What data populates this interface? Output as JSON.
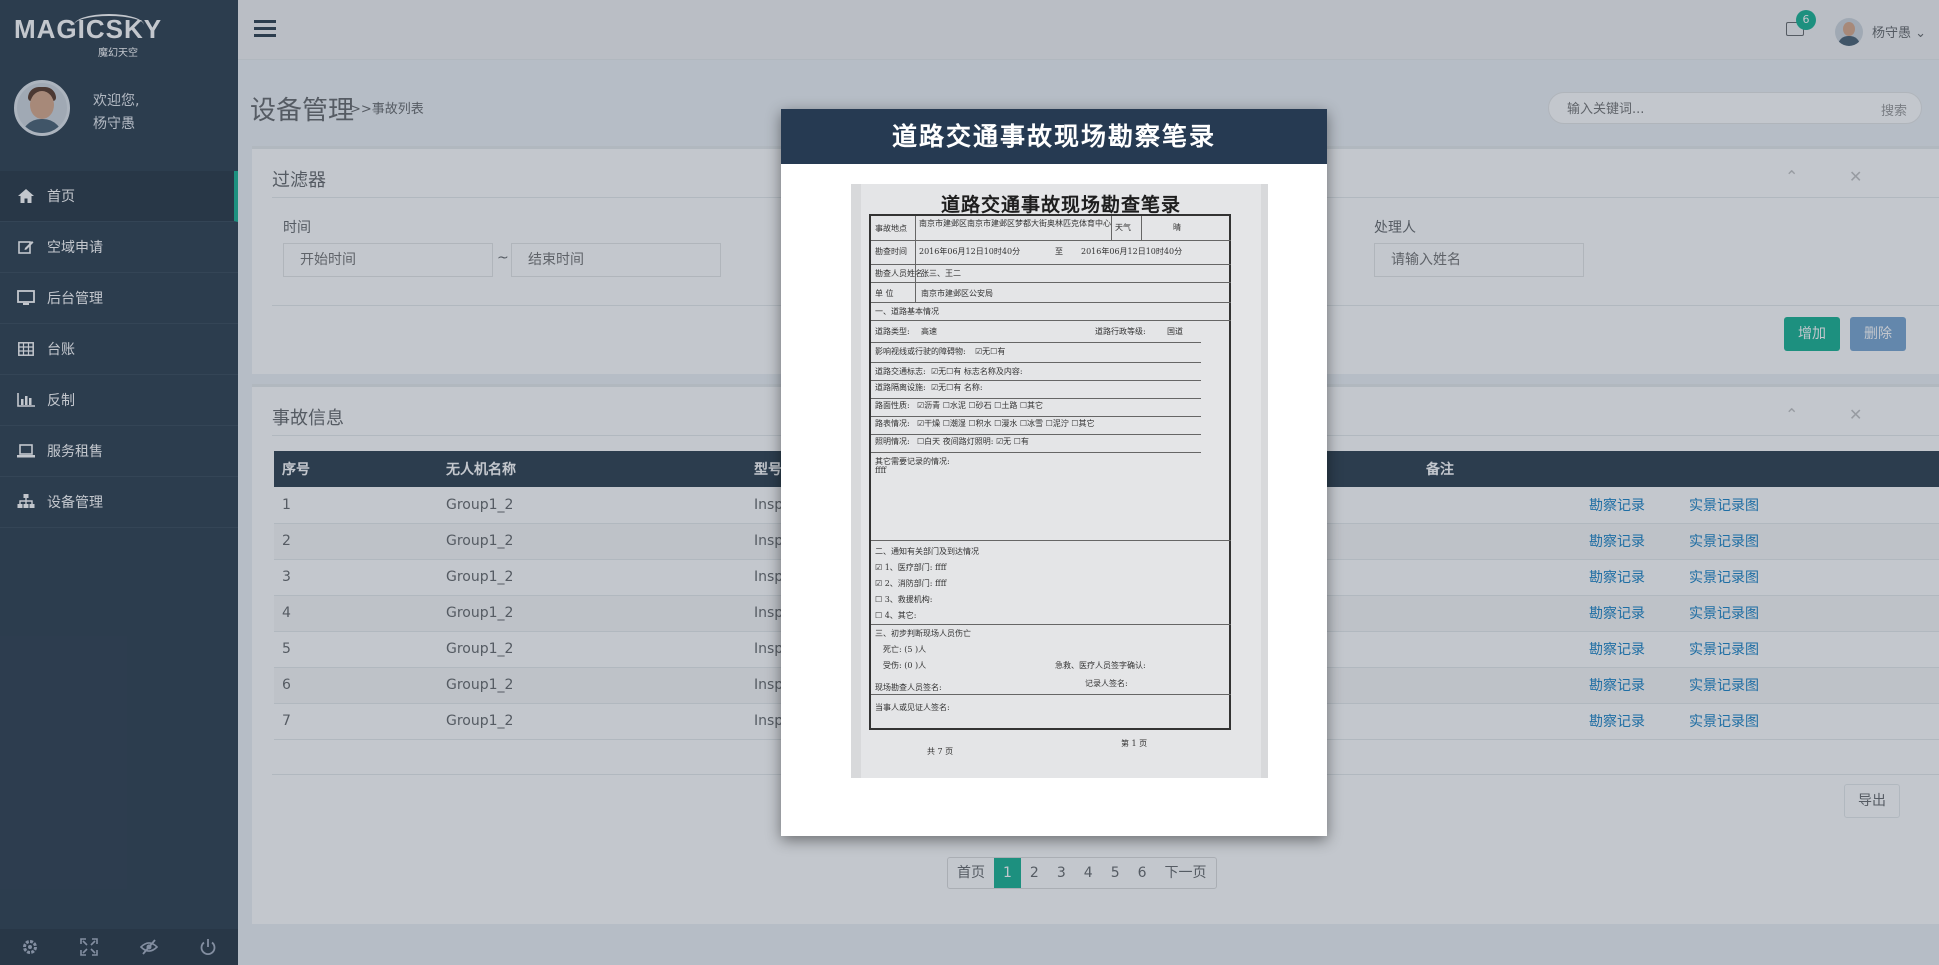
{
  "sidebar": {
    "logo": "MAGICSKY",
    "logo_sub": "魔幻天空",
    "welcome": "欢迎您,",
    "user": "杨守愚",
    "items": [
      {
        "label": "首页",
        "icon": "home-icon"
      },
      {
        "label": "空域申请",
        "icon": "edit-icon"
      },
      {
        "label": "后台管理",
        "icon": "desktop-icon"
      },
      {
        "label": "台账",
        "icon": "table-icon"
      },
      {
        "label": "反制",
        "icon": "bar-chart-icon"
      },
      {
        "label": "服务租售",
        "icon": "laptop-icon"
      },
      {
        "label": "设备管理",
        "icon": "sitemap-icon"
      }
    ],
    "footer_icons": [
      "gear-icon",
      "fullscreen-icon",
      "eye-slash-icon",
      "power-icon"
    ]
  },
  "topbar": {
    "badge": "6",
    "user": "杨守愚"
  },
  "header": {
    "title": "设备管理",
    "crumb": ">>事故列表",
    "search_placeholder": "输入关键词...",
    "search_btn": "搜索"
  },
  "filter": {
    "title": "过滤器",
    "time_label": "时间",
    "start_placeholder": "开始时间",
    "sep": "~",
    "end_placeholder": "结束时间",
    "handler_label": "处理人",
    "handler_placeholder": "请输入姓名",
    "add_btn": "增加",
    "delete_btn": "删除"
  },
  "accidents": {
    "title": "事故信息",
    "columns": [
      "序号",
      "无人机名称",
      "型号",
      "备注"
    ],
    "rows": [
      {
        "no": "1",
        "name": "Group1_2",
        "model": "Insp"
      },
      {
        "no": "2",
        "name": "Group1_2",
        "model": "Insp"
      },
      {
        "no": "3",
        "name": "Group1_2",
        "model": "Insp"
      },
      {
        "no": "4",
        "name": "Group1_2",
        "model": "Insp"
      },
      {
        "no": "5",
        "name": "Group1_2",
        "model": "Insp"
      },
      {
        "no": "6",
        "name": "Group1_2",
        "model": "Insp"
      },
      {
        "no": "7",
        "name": "Group1_2",
        "model": "Insp"
      }
    ],
    "link1": "勘察记录",
    "link2": "实景记录图",
    "export": "导出"
  },
  "pager": [
    "首页",
    "1",
    "2",
    "3",
    "4",
    "5",
    "6",
    "下一页"
  ],
  "modal": {
    "title": "道路交通事故现场勘察笔录",
    "doc": {
      "title": "道路交通事故现场勘查笔录",
      "rows": [
        "事故地点",
        "南京市建邺区南京市建邺区梦都大街奥林匹克体育中心",
        "天气",
        "晴",
        "勘查时间",
        "2016年06月12日10时40分",
        "至",
        "2016年06月12日10时40分",
        "勘查人员姓名",
        "张三、王二",
        "单 位",
        "南京市建邺区公安局",
        "一、道路基本情况",
        "道路类型:",
        "高速",
        "道路行政等级:",
        "国道",
        "影响视线或行驶的障碍物:",
        "☑无☐有",
        "道路交通标志:",
        "☑无☐有 标志名称及内容:",
        "道路隔离设施:",
        "☑无☐有 名称:",
        "路面性质:",
        "☑沥青 ☐水泥 ☐砂石 ☐土路 ☐其它",
        "路表情况:",
        "☑干燥 ☐潮湿 ☐积水 ☐漫水 ☐冰雪 ☐泥泞 ☐其它",
        "照明情况:",
        "☐白天 夜间路灯照明: ☑无 ☐有",
        "其它需要记录的情况:",
        "ffff",
        "二、通知有关部门及到达情况",
        "☑ 1、医疗部门: ffff",
        "☑ 2、消防部门: ffff",
        "☐ 3、救援机构:",
        "☐ 4、其它:",
        "三、初步判断现场人员伤亡",
        "死亡: (5 )人",
        "受伤: (0 )人",
        "急救、医疗人员签字确认:",
        "现场勘查人员签名:",
        "记录人签名:",
        "当事人或见证人签名:",
        "共 7 页",
        "第 1 页"
      ]
    }
  }
}
